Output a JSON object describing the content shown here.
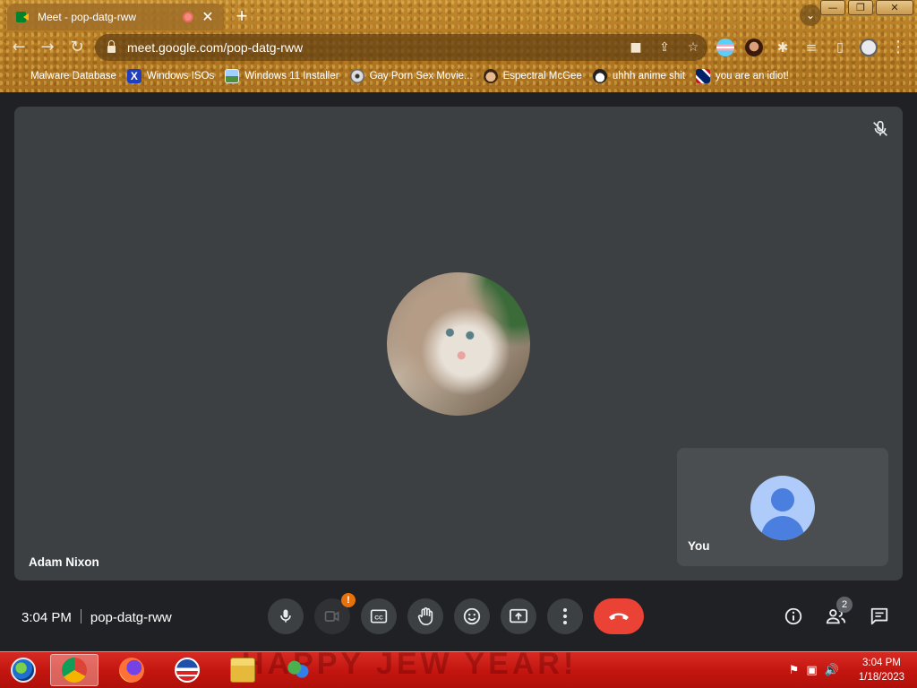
{
  "browser": {
    "tab": {
      "title": "Meet - pop-datg-rww"
    },
    "new_tab_symbol": "+",
    "url": "meet.google.com/pop-datg-rww",
    "window_buttons": [
      "—",
      "❐",
      "✕"
    ],
    "bookmarks": [
      {
        "label": "Malware Database",
        "icon": "warning-icon"
      },
      {
        "label": "Windows ISOs",
        "icon": "x-logo-icon"
      },
      {
        "label": "Windows 11 Installer",
        "icon": "image-icon"
      },
      {
        "label": "Gay Porn Sex Movie...",
        "icon": "cd-icon"
      },
      {
        "label": "Espectral McGee",
        "icon": "face-icon"
      },
      {
        "label": "uhhh anime shit",
        "icon": "anime-icon"
      },
      {
        "label": "you are an idiot!",
        "icon": "flag-icon"
      }
    ]
  },
  "meet": {
    "main_participant": {
      "name": "Adam Nixon",
      "avatar": "kitten-photo",
      "muted": true
    },
    "self_tile": {
      "label": "You"
    },
    "time": "3:04 PM",
    "meeting_code": "pop-datg-rww",
    "camera_warning": "!",
    "people_count": "2",
    "colors": {
      "end_call": "#ea4335",
      "stage": "#3c4043",
      "background": "#202124"
    }
  },
  "taskbar": {
    "background_text": "HAPPY JEW YEAR!",
    "apps": [
      "start-orb",
      "chrome",
      "firefox",
      "obama-logo",
      "file-explorer",
      "windows-live-messenger"
    ],
    "clock_time": "3:04 PM",
    "clock_date": "1/18/2023"
  }
}
